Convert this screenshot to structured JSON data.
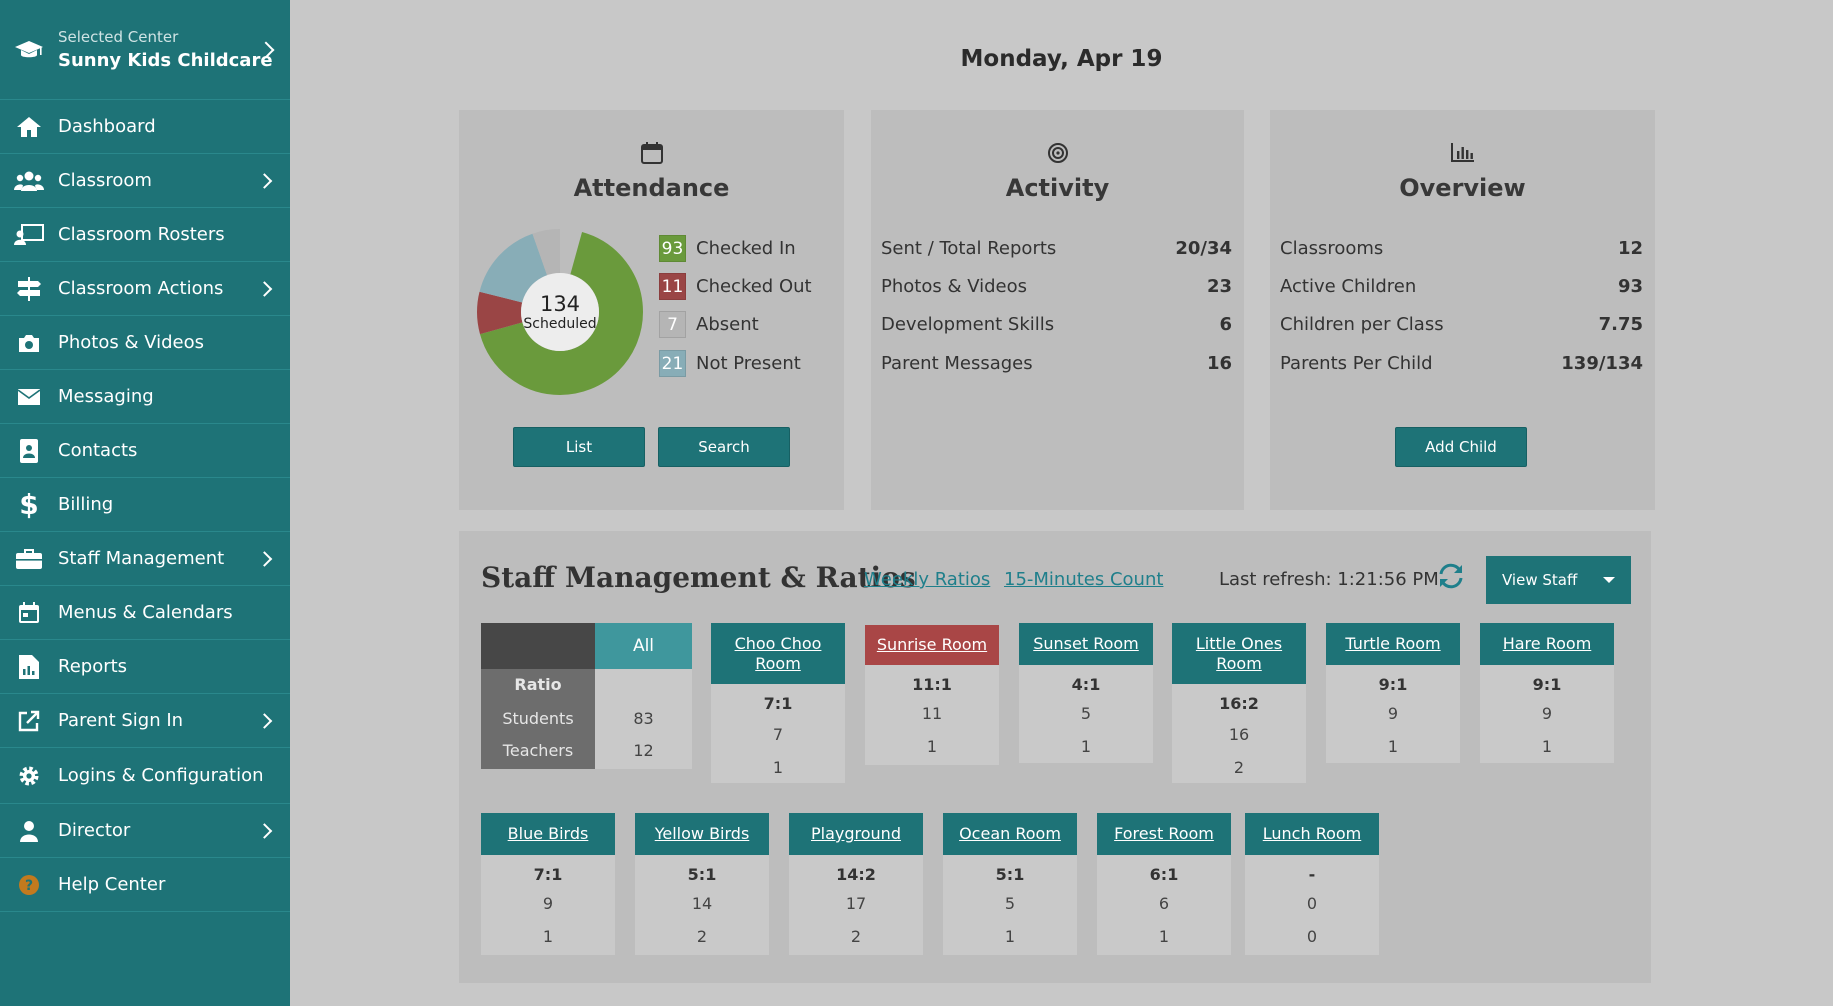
{
  "sidebar": {
    "center_sub": "Selected Center",
    "center_name": "Sunny Kids Childcare",
    "items": [
      {
        "label": "Dashboard"
      },
      {
        "label": "Classroom"
      },
      {
        "label": "Classroom Rosters"
      },
      {
        "label": "Classroom Actions"
      },
      {
        "label": "Photos & Videos"
      },
      {
        "label": "Messaging"
      },
      {
        "label": "Contacts"
      },
      {
        "label": "Billing"
      },
      {
        "label": "Staff Management"
      },
      {
        "label": "Menus & Calendars"
      },
      {
        "label": "Reports"
      },
      {
        "label": "Parent Sign In"
      },
      {
        "label": "Logins & Configuration"
      },
      {
        "label": "Director"
      },
      {
        "label": "Help Center"
      }
    ]
  },
  "header": {
    "date": "Monday, Apr 19"
  },
  "attendance": {
    "title": "Attendance",
    "scheduled_count": "134",
    "scheduled_label": "Scheduled",
    "legend": [
      {
        "count": "93",
        "label": "Checked In",
        "color": "#6a9a3c"
      },
      {
        "count": "11",
        "label": "Checked Out",
        "color": "#9a4545"
      },
      {
        "count": "7",
        "label": "Absent",
        "color": "#b5b5b5"
      },
      {
        "count": "21",
        "label": "Not Present",
        "color": "#88adb7"
      }
    ],
    "list_button": "List",
    "search_button": "Search"
  },
  "activity": {
    "title": "Activity",
    "rows": [
      {
        "label": "Sent / Total Reports",
        "value": "20/34"
      },
      {
        "label": "Photos & Videos",
        "value": "23"
      },
      {
        "label": "Development Skills",
        "value": "6"
      },
      {
        "label": "Parent Messages",
        "value": "16"
      }
    ]
  },
  "overview": {
    "title": "Overview",
    "rows": [
      {
        "label": "Classrooms",
        "value": "12"
      },
      {
        "label": "Active Children",
        "value": "93"
      },
      {
        "label": "Children per Class",
        "value": "7.75"
      },
      {
        "label": "Parents Per Child",
        "value": "139/134"
      }
    ],
    "add_child_button": "Add Child"
  },
  "staff": {
    "title": "Staff Management & Ratios",
    "weekly_link": "Weekly Ratios",
    "count_link": "15-Minutes Count",
    "last_refresh": "Last refresh: 1:21:56 PM",
    "view_staff_button": "View Staff",
    "all": {
      "header": "All",
      "ratio_label": "Ratio",
      "students_label": "Students",
      "teachers_label": "Teachers",
      "students": "83",
      "teachers": "12"
    },
    "rooms": [
      {
        "name": "Choo Choo Room",
        "ratio": "7:1",
        "students": "7",
        "teachers": "1"
      },
      {
        "name": "Sunrise Room",
        "ratio": "11:1",
        "students": "11",
        "teachers": "1"
      },
      {
        "name": "Sunset Room",
        "ratio": "4:1",
        "students": "5",
        "teachers": "1"
      },
      {
        "name": "Little Ones Room",
        "ratio": "16:2",
        "students": "16",
        "teachers": "2"
      },
      {
        "name": "Turtle Room",
        "ratio": "9:1",
        "students": "9",
        "teachers": "1"
      },
      {
        "name": "Hare Room",
        "ratio": "9:1",
        "students": "9",
        "teachers": "1"
      },
      {
        "name": "Blue Birds",
        "ratio": "7:1",
        "students": "9",
        "teachers": "1"
      },
      {
        "name": "Yellow Birds",
        "ratio": "5:1",
        "students": "14",
        "teachers": "2"
      },
      {
        "name": "Playground",
        "ratio": "14:2",
        "students": "17",
        "teachers": "2"
      },
      {
        "name": "Ocean Room",
        "ratio": "5:1",
        "students": "5",
        "teachers": "1"
      },
      {
        "name": "Forest Room",
        "ratio": "6:1",
        "students": "6",
        "teachers": "1"
      },
      {
        "name": "Lunch Room",
        "ratio": "-",
        "students": "0",
        "teachers": "0"
      }
    ]
  }
}
